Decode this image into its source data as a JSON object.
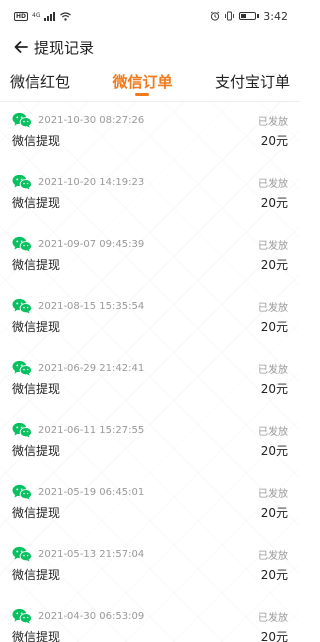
{
  "status_bar": {
    "network_badge": "HD",
    "network_type": "4G",
    "time": "3:42",
    "battery_level": 0.35
  },
  "header": {
    "title": "提现记录"
  },
  "tabs": [
    {
      "label": "微信红包",
      "active": false
    },
    {
      "label": "微信订单",
      "active": true
    },
    {
      "label": "支付宝订单",
      "active": false
    }
  ],
  "colors": {
    "accent": "#f07a1d",
    "wechat_green": "#07c160"
  },
  "records": [
    {
      "time": "2021-10-30 08:27:26",
      "status": "已发放",
      "title": "微信提现",
      "amount": "20元",
      "icon": "wechat-icon"
    },
    {
      "time": "2021-10-20 14:19:23",
      "status": "已发放",
      "title": "微信提现",
      "amount": "20元",
      "icon": "wechat-icon"
    },
    {
      "time": "2021-09-07 09:45:39",
      "status": "已发放",
      "title": "微信提现",
      "amount": "20元",
      "icon": "wechat-icon"
    },
    {
      "time": "2021-08-15 15:35:54",
      "status": "已发放",
      "title": "微信提现",
      "amount": "20元",
      "icon": "wechat-icon"
    },
    {
      "time": "2021-06-29 21:42:41",
      "status": "已发放",
      "title": "微信提现",
      "amount": "20元",
      "icon": "wechat-icon"
    },
    {
      "time": "2021-06-11 15:27:55",
      "status": "已发放",
      "title": "微信提现",
      "amount": "20元",
      "icon": "wechat-icon"
    },
    {
      "time": "2021-05-19 06:45:01",
      "status": "已发放",
      "title": "微信提现",
      "amount": "20元",
      "icon": "wechat-icon"
    },
    {
      "time": "2021-05-13 21:57:04",
      "status": "已发放",
      "title": "微信提现",
      "amount": "20元",
      "icon": "wechat-icon"
    },
    {
      "time": "2021-04-30 06:53:09",
      "status": "已发放",
      "title": "微信提现",
      "amount": "20元",
      "icon": "wechat-icon"
    }
  ]
}
